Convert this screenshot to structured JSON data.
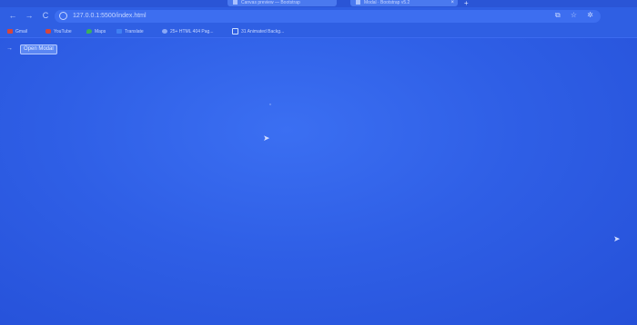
{
  "browser": {
    "tabs": [
      {
        "label": "Canvas preview — Bootstrap"
      },
      {
        "label": "Modal · Bootstrap v5.2"
      }
    ],
    "new_tab_glyph": "+",
    "nav": {
      "back": "←",
      "forward": "→",
      "reload": "C"
    },
    "address": "127.0.0.1:5500/index.html",
    "omnibox_actions": [
      "⧉",
      "☆",
      "✲"
    ]
  },
  "bookmarks": [
    {
      "label": "Gmail",
      "icon": "gmail-icon"
    },
    {
      "label": "YouTube",
      "icon": "youtube-icon"
    },
    {
      "label": "Maps",
      "icon": "maps-icon"
    },
    {
      "label": "Translate",
      "icon": "translate-icon"
    },
    {
      "label": "25+ HTML 404 Pag...",
      "icon": "globe-icon"
    },
    {
      "label": "31 Animated Backg...",
      "icon": "bookmark-page-icon"
    }
  ],
  "page": {
    "arrow": "→",
    "open_modal_label": "Open Modal"
  },
  "colors": {
    "background": "#2f5fe6",
    "button": "#5b87f4"
  }
}
